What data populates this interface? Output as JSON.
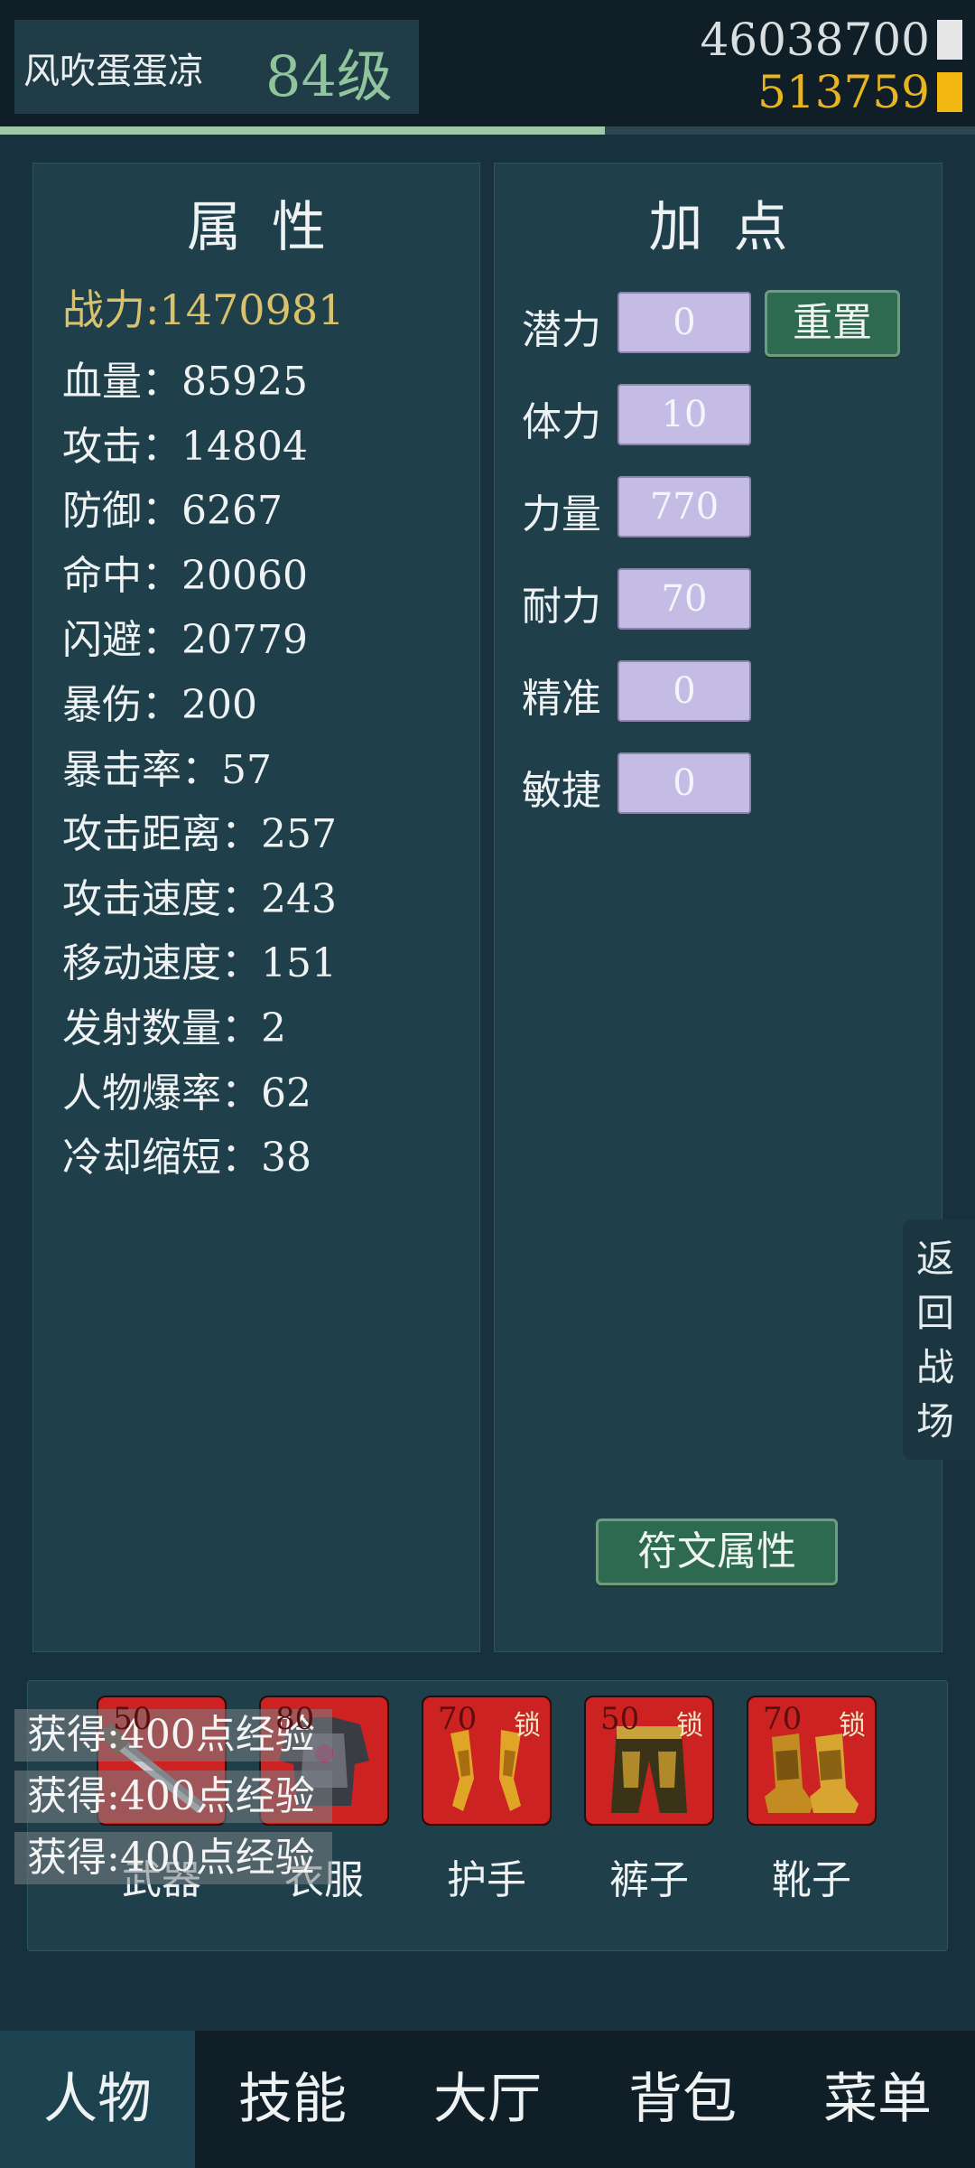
{
  "player": {
    "name": "风吹蛋蛋凉",
    "level": "84级"
  },
  "currency": {
    "amount1": "46038700",
    "amount2": "513759"
  },
  "colors": {
    "accent": "#8fc49c",
    "gold": "#e8b520",
    "attr_box": "#c4bce4",
    "button": "#2e6a50",
    "equip_bg": "#cc2222"
  },
  "exp_progress": 0.62,
  "attributes": {
    "title": "属性",
    "power": "战力:1470981",
    "stats": [
      "血量：85925",
      "攻击：14804",
      "防御：6267",
      "命中：20060",
      "闪避：20779",
      "暴伤：200",
      "暴击率：57",
      "攻击距离：257",
      "攻击速度：243",
      "移动速度：151",
      "发射数量：2",
      "人物爆率：62",
      "冷却缩短：38"
    ]
  },
  "allocate": {
    "title": "加点",
    "reset_label": "重置",
    "rune_label": "符文属性",
    "rows": [
      {
        "label": "潜力",
        "value": "0"
      },
      {
        "label": "体力",
        "value": "10"
      },
      {
        "label": "力量",
        "value": "770"
      },
      {
        "label": "耐力",
        "value": "70"
      },
      {
        "label": "精准",
        "value": "0"
      },
      {
        "label": "敏捷",
        "value": "0"
      }
    ]
  },
  "return_label": [
    "返",
    "回",
    "战",
    "场"
  ],
  "equipment": [
    {
      "level": "50",
      "lock": "",
      "label": "武器",
      "icon": "sword-icon"
    },
    {
      "level": "80",
      "lock": "",
      "label": "衣服",
      "icon": "armor-icon"
    },
    {
      "level": "70",
      "lock": "锁",
      "label": "护手",
      "icon": "gauntlet-icon"
    },
    {
      "level": "50",
      "lock": "锁",
      "label": "裤子",
      "icon": "pants-icon"
    },
    {
      "level": "70",
      "lock": "锁",
      "label": "靴子",
      "icon": "boots-icon"
    }
  ],
  "toasts": [
    "获得:400点经验",
    "获得:400点经验",
    "获得:400点经验"
  ],
  "nav": {
    "tabs": [
      "人物",
      "技能",
      "大厅",
      "背包",
      "菜单"
    ],
    "active": 0
  }
}
